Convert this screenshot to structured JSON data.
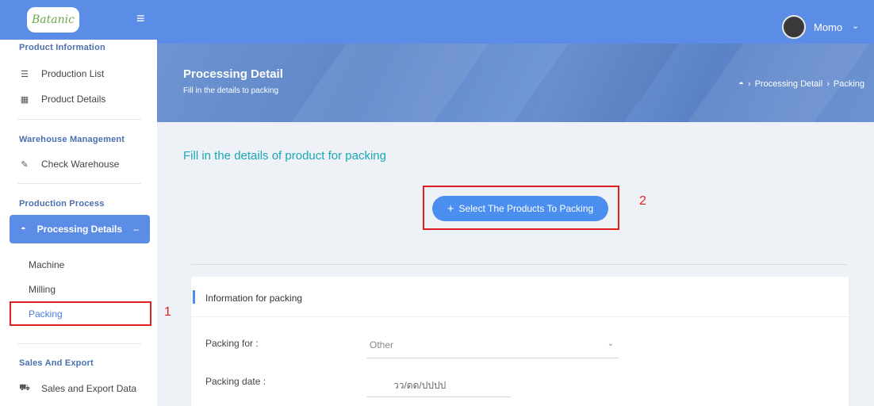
{
  "brand": {
    "logo_text": "Batanic"
  },
  "sidebar": {
    "sections": [
      {
        "title": "Product Information"
      },
      {
        "title": "Warehouse Management"
      },
      {
        "title": "Production Process"
      },
      {
        "title": "Sales And Export"
      }
    ],
    "items": [
      {
        "label": "Production List",
        "icon": "list-icon"
      },
      {
        "label": "Product Details",
        "icon": "grid-icon"
      },
      {
        "label": "Check Warehouse",
        "icon": "edit-icon"
      },
      {
        "label": "Processing Details",
        "icon": "dashboard-icon",
        "active": true,
        "toggle": "–"
      },
      {
        "label": "Sales and Export Data",
        "icon": "cart-icon"
      }
    ],
    "sub_items": [
      {
        "label": "Machine"
      },
      {
        "label": "Milling"
      },
      {
        "label": "Packing",
        "selected": true
      }
    ]
  },
  "topbar": {
    "user_name": "Momo"
  },
  "banner": {
    "title": "Processing Detail",
    "subtitle": "Fill in the details to packing",
    "breadcrumb": [
      "Processing Detail",
      "Packing"
    ]
  },
  "main": {
    "heading": "Fill in the details of product for packing",
    "select_button": "Select The Products To Packing",
    "card_title": "Information for packing",
    "fields": [
      {
        "label": "Packing for :",
        "value": "Other"
      },
      {
        "label": "Packing date :",
        "value": "วว/ดด/ปปปป"
      }
    ]
  },
  "annotations": [
    "1",
    "2"
  ],
  "colors": {
    "primary": "#5b8de6",
    "button": "#4a8ff0",
    "heading": "#1aa7b8",
    "annotation": "#e02020"
  }
}
